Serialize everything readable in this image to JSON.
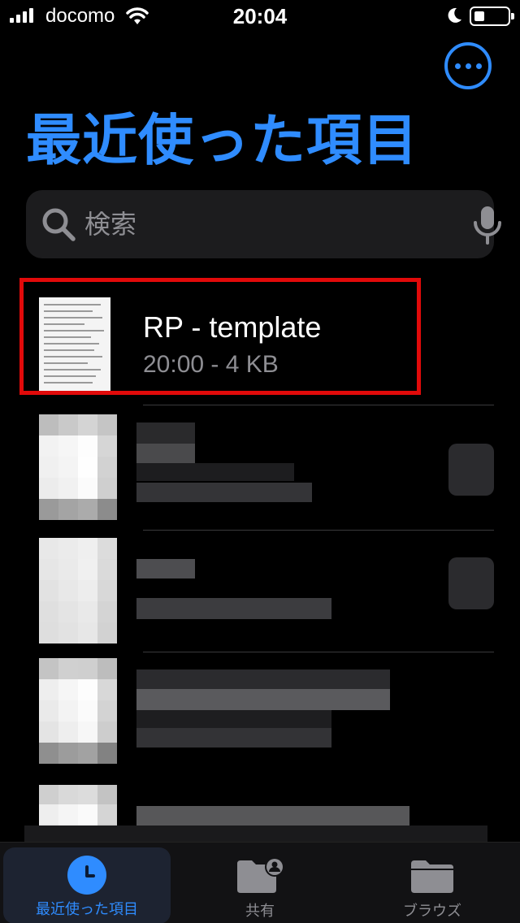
{
  "status_bar": {
    "carrier": "docomo",
    "time": "20:04"
  },
  "header": {
    "title": "最近使った項目",
    "more_icon": "ellipsis-circle-icon",
    "accent_color": "#2f8cff"
  },
  "search": {
    "placeholder": "検索",
    "icon": "search-icon",
    "mic_icon": "mic-icon"
  },
  "files": [
    {
      "name": "RP - template",
      "meta": "20:00 - 4 KB",
      "highlighted": true,
      "highlight_color": "#e10a0a"
    }
  ],
  "tab_bar": {
    "tabs": [
      {
        "label": "最近使った項目",
        "icon": "clock-icon",
        "selected": true
      },
      {
        "label": "共有",
        "icon": "shared-folder-icon",
        "selected": false
      },
      {
        "label": "ブラウズ",
        "icon": "folder-icon",
        "selected": false
      }
    ]
  }
}
